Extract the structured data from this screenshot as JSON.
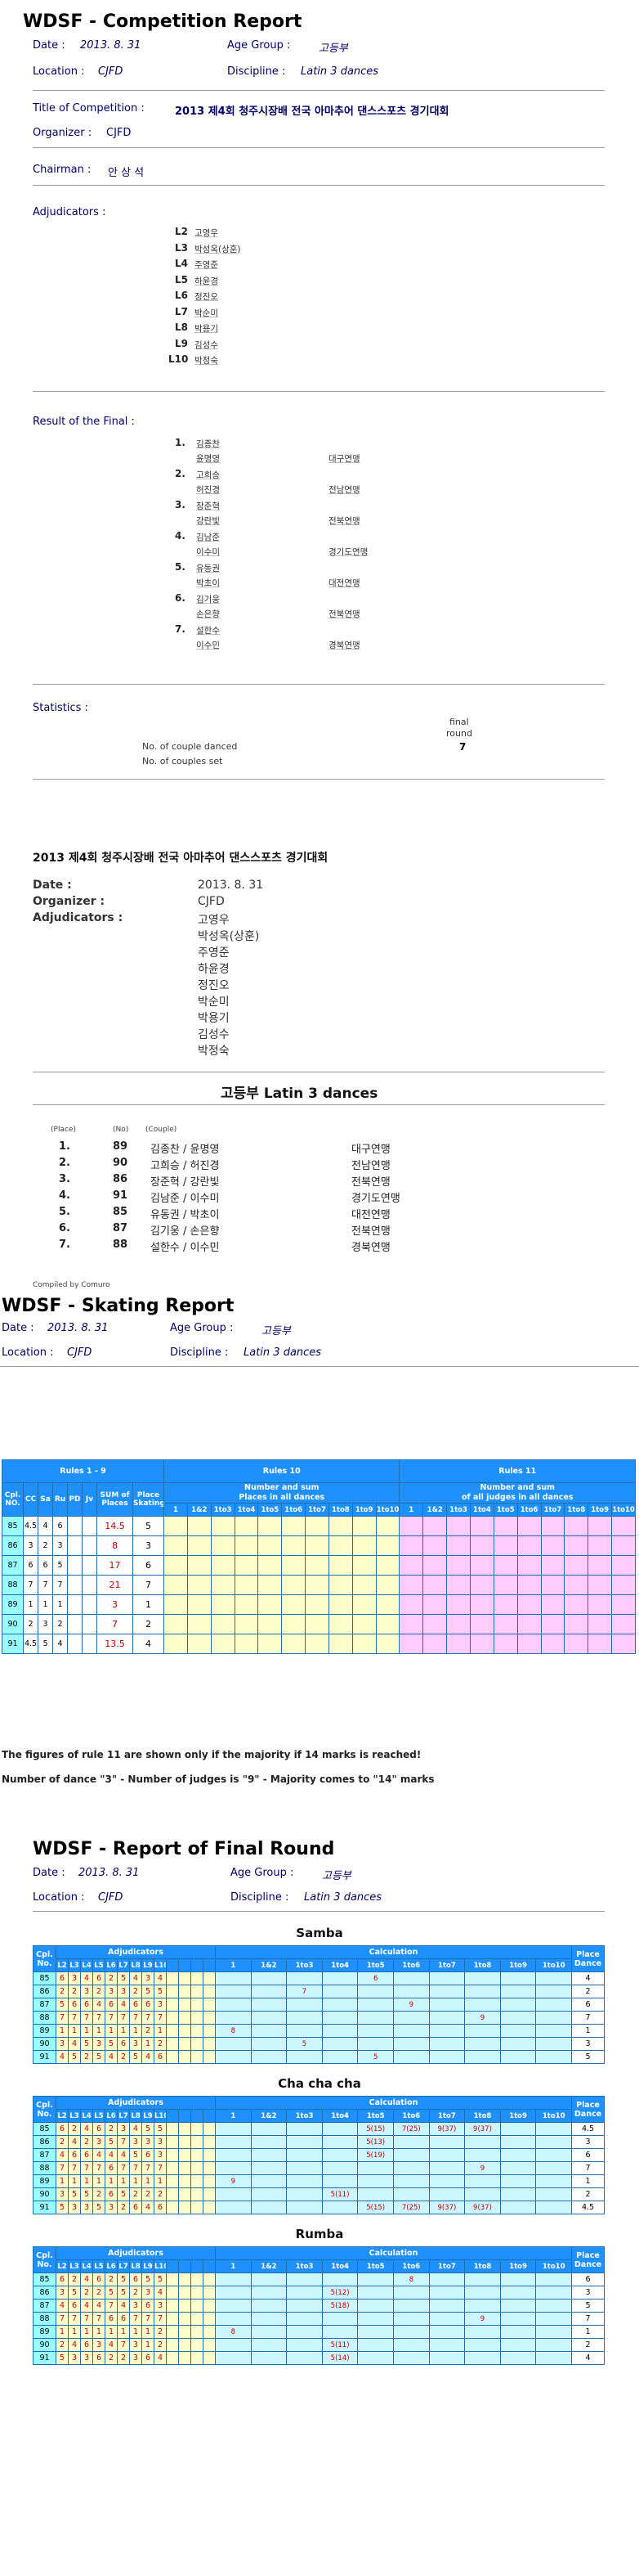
{
  "title": "WDSF - Competition Report",
  "meta": {
    "date_label": "Date :",
    "date": "2013. 8. 31",
    "age_label": "Age Group :",
    "age": "고등부",
    "loc_label": "Location :",
    "loc": "CJFD",
    "disc_label": "Discipline :",
    "disc": "Latin 3 dances"
  },
  "comp_label": "Title of Competition :",
  "comp": "2013 제4회 청주시장배 전국 아마추어 댄스스포츠 경기대회",
  "org_label": "Organizer :",
  "org": "CJFD",
  "chair_label": "Chairman :",
  "chair": "안 상 석",
  "adj_label": "Adjudicators :",
  "adjudicators": [
    {
      "code": "L2",
      "name": "고영우"
    },
    {
      "code": "L3",
      "name": "박성옥(상훈)"
    },
    {
      "code": "L4",
      "name": "주영준"
    },
    {
      "code": "L5",
      "name": "하윤경"
    },
    {
      "code": "L6",
      "name": "정진오"
    },
    {
      "code": "L7",
      "name": "박순미"
    },
    {
      "code": "L8",
      "name": "박용기"
    },
    {
      "code": "L9",
      "name": "김성수"
    },
    {
      "code": "L10",
      "name": "박정숙"
    }
  ],
  "final_label": "Result of the Final :",
  "finals": [
    {
      "place": "1.",
      "m": "김종찬",
      "f": "윤명영",
      "club": "대구연맹"
    },
    {
      "place": "2.",
      "m": "고희승",
      "f": "허진경",
      "club": "전남연맹"
    },
    {
      "place": "3.",
      "m": "장준혁",
      "f": "강란빛",
      "club": "전북연맹"
    },
    {
      "place": "4.",
      "m": "김남준",
      "f": "이수미",
      "club": "경기도연맹"
    },
    {
      "place": "5.",
      "m": "유동권",
      "f": "박초이",
      "club": "대전연맹"
    },
    {
      "place": "6.",
      "m": "김기웅",
      "f": "손은향",
      "club": "전북연맹"
    },
    {
      "place": "7.",
      "m": "설한수",
      "f": "이수민",
      "club": "경북연맹"
    }
  ],
  "stats": {
    "label": "Statistics :",
    "col1": "final",
    "col2": "round",
    "row1": "No. of couple danced",
    "row2": "No. of couples set",
    "value": "7"
  },
  "kr": {
    "title": "2013 제4회 청주시장배 전국 아마추어 댄스스포츠 경기대회",
    "date_label": "Date :",
    "date": "2013. 8. 31",
    "org_label": "Organizer :",
    "org": "CJFD",
    "adj_label": "Adjudicators :",
    "heading": "고등부 Latin 3 dances",
    "h_place": "(Place)",
    "h_no": "(No)",
    "h_couple": "(Couple)",
    "compiled": "Compiled by Comuro",
    "rows": [
      {
        "place": "1.",
        "no": "89",
        "couple": "김종찬 /  윤명영",
        "club": "대구연맹"
      },
      {
        "place": "2.",
        "no": "90",
        "couple": "고희승 /  허진경",
        "club": "전남연맹"
      },
      {
        "place": "3.",
        "no": "86",
        "couple": "장준혁 /  강란빛",
        "club": "전북연맹"
      },
      {
        "place": "4.",
        "no": "91",
        "couple": "김남준 /  이수미",
        "club": "경기도연맹"
      },
      {
        "place": "5.",
        "no": "85",
        "couple": "유동권 /  박초이",
        "club": "대전연맹"
      },
      {
        "place": "6.",
        "no": "87",
        "couple": "김기웅 /  손은향",
        "club": "전북연맹"
      },
      {
        "place": "7.",
        "no": "88",
        "couple": "설한수 /  이수민",
        "club": "경북연맹"
      }
    ]
  },
  "skating": {
    "title": "WDSF - Skating Report",
    "hdr_r19": "Rules 1 - 9",
    "hdr_r10": "Rules 10",
    "hdr_r11": "Rules 11",
    "r10_sub": "Number and sum",
    "r10_sub2": "Places in all dances",
    "r11_sub": "Number and sum",
    "r11_sub2": "of all judges in all dances",
    "cols": [
      "Cpl. NO.",
      "CC",
      "Sa",
      "Ru",
      "PD",
      "Jv",
      "SUM of Places",
      "Place Skating"
    ],
    "rank_cols": [
      "1",
      "1&2",
      "1to3",
      "1to4",
      "1to5",
      "1to6",
      "1to7",
      "1to8",
      "1to9",
      "1to10"
    ],
    "rows": [
      {
        "no": "85",
        "cc": "4.5",
        "sa": "4",
        "ru": "6",
        "sum": "14.5",
        "place": "5"
      },
      {
        "no": "86",
        "cc": "3",
        "sa": "2",
        "ru": "3",
        "sum": "8",
        "place": "3"
      },
      {
        "no": "87",
        "cc": "6",
        "sa": "6",
        "ru": "5",
        "sum": "17",
        "place": "6"
      },
      {
        "no": "88",
        "cc": "7",
        "sa": "7",
        "ru": "7",
        "sum": "21",
        "place": "7"
      },
      {
        "no": "89",
        "cc": "1",
        "sa": "1",
        "ru": "1",
        "sum": "3",
        "place": "1"
      },
      {
        "no": "90",
        "cc": "2",
        "sa": "3",
        "ru": "2",
        "sum": "7",
        "place": "2"
      },
      {
        "no": "91",
        "cc": "4.5",
        "sa": "5",
        "ru": "4",
        "sum": "13.5",
        "place": "4"
      }
    ],
    "note1": "The figures of rule 11 are shown only if the majority if 14 marks is reached!",
    "note2": "Number of dance \"3\" - Number of judges is \"9\" - Majority comes to \"14\" marks"
  },
  "final_round": {
    "title": "WDSF - Report of Final Round",
    "hdr_adj": "Adjudicators",
    "hdr_calc": "Calculation",
    "hdr_cpl": "Cpl. No.",
    "hdr_place": "Place Dance",
    "judges": [
      "L2",
      "L3",
      "L4",
      "L5",
      "L6",
      "L7",
      "L8",
      "L9",
      "L10"
    ],
    "calc_cols": [
      "1",
      "1&2",
      "1to3",
      "1to4",
      "1to5",
      "1to6",
      "1to7",
      "1to8",
      "1to9",
      "1to10"
    ],
    "dances": [
      {
        "name": "Samba",
        "rows": [
          {
            "no": "85",
            "marks": [
              "6",
              "3",
              "4",
              "6",
              "2",
              "5",
              "4",
              "3",
              "4"
            ],
            "calc": [
              "",
              "",
              "",
              "",
              "6",
              "",
              "",
              "",
              "",
              ""
            ],
            "place": "4"
          },
          {
            "no": "86",
            "marks": [
              "2",
              "2",
              "3",
              "2",
              "3",
              "3",
              "2",
              "5",
              "5"
            ],
            "calc": [
              "",
              "",
              "7",
              "",
              "",
              "",
              "",
              "",
              "",
              ""
            ],
            "place": "2"
          },
          {
            "no": "87",
            "marks": [
              "5",
              "6",
              "6",
              "4",
              "6",
              "4",
              "6",
              "6",
              "3"
            ],
            "calc": [
              "",
              "",
              "",
              "",
              "",
              "9",
              "",
              "",
              "",
              ""
            ],
            "place": "6"
          },
          {
            "no": "88",
            "marks": [
              "7",
              "7",
              "7",
              "7",
              "7",
              "7",
              "7",
              "7",
              "7"
            ],
            "calc": [
              "",
              "",
              "",
              "",
              "",
              "",
              "",
              "9",
              "",
              ""
            ],
            "place": "7"
          },
          {
            "no": "89",
            "marks": [
              "1",
              "1",
              "1",
              "1",
              "1",
              "1",
              "1",
              "2",
              "1"
            ],
            "calc": [
              "8",
              "",
              "",
              "",
              "",
              "",
              "",
              "",
              "",
              ""
            ],
            "place": "1"
          },
          {
            "no": "90",
            "marks": [
              "3",
              "4",
              "5",
              "3",
              "5",
              "6",
              "3",
              "1",
              "2"
            ],
            "calc": [
              "",
              "",
              "5",
              "",
              "",
              "",
              "",
              "",
              "",
              ""
            ],
            "place": "3"
          },
          {
            "no": "91",
            "marks": [
              "4",
              "5",
              "2",
              "5",
              "4",
              "2",
              "5",
              "4",
              "6"
            ],
            "calc": [
              "",
              "",
              "",
              "",
              "5",
              "",
              "",
              "",
              "",
              ""
            ],
            "place": "5"
          }
        ]
      },
      {
        "name": "Cha cha cha",
        "rows": [
          {
            "no": "85",
            "marks": [
              "6",
              "2",
              "4",
              "6",
              "2",
              "3",
              "4",
              "5",
              "5"
            ],
            "calc": [
              "",
              "",
              "",
              "",
              "5(15)",
              "7(25)",
              "9(37)",
              "9(37)",
              "",
              ""
            ],
            "place": "4.5"
          },
          {
            "no": "86",
            "marks": [
              "2",
              "4",
              "2",
              "3",
              "5",
              "7",
              "3",
              "3",
              "3"
            ],
            "calc": [
              "",
              "",
              "",
              "",
              "5(13)",
              "",
              "",
              "",
              "",
              ""
            ],
            "place": "3"
          },
          {
            "no": "87",
            "marks": [
              "4",
              "6",
              "6",
              "4",
              "4",
              "4",
              "5",
              "6",
              "3"
            ],
            "calc": [
              "",
              "",
              "",
              "",
              "5(19)",
              "",
              "",
              "",
              "",
              ""
            ],
            "place": "6"
          },
          {
            "no": "88",
            "marks": [
              "7",
              "7",
              "7",
              "7",
              "6",
              "7",
              "7",
              "7",
              "7"
            ],
            "calc": [
              "",
              "",
              "",
              "",
              "",
              "",
              "",
              "9",
              "",
              ""
            ],
            "place": "7"
          },
          {
            "no": "89",
            "marks": [
              "1",
              "1",
              "1",
              "1",
              "1",
              "1",
              "1",
              "1",
              "1"
            ],
            "calc": [
              "9",
              "",
              "",
              "",
              "",
              "",
              "",
              "",
              "",
              ""
            ],
            "place": "1"
          },
          {
            "no": "90",
            "marks": [
              "3",
              "5",
              "5",
              "2",
              "6",
              "5",
              "2",
              "2",
              "2"
            ],
            "calc": [
              "",
              "",
              "",
              "5(11)",
              "",
              "",
              "",
              "",
              "",
              ""
            ],
            "place": "2"
          },
          {
            "no": "91",
            "marks": [
              "5",
              "3",
              "3",
              "5",
              "3",
              "2",
              "6",
              "4",
              "6"
            ],
            "calc": [
              "",
              "",
              "",
              "",
              "5(15)",
              "7(25)",
              "9(37)",
              "9(37)",
              "",
              ""
            ],
            "place": "4.5"
          }
        ]
      },
      {
        "name": "Rumba",
        "rows": [
          {
            "no": "85",
            "marks": [
              "6",
              "2",
              "4",
              "6",
              "2",
              "5",
              "6",
              "5",
              "5"
            ],
            "calc": [
              "",
              "",
              "",
              "",
              "",
              "8",
              "",
              "",
              "",
              ""
            ],
            "place": "6"
          },
          {
            "no": "86",
            "marks": [
              "3",
              "5",
              "2",
              "2",
              "5",
              "5",
              "2",
              "3",
              "4"
            ],
            "calc": [
              "",
              "",
              "",
              "5(12)",
              "",
              "",
              "",
              "",
              "",
              ""
            ],
            "place": "3"
          },
          {
            "no": "87",
            "marks": [
              "4",
              "6",
              "4",
              "4",
              "7",
              "4",
              "3",
              "6",
              "3"
            ],
            "calc": [
              "",
              "",
              "",
              "5(18)",
              "",
              "",
              "",
              "",
              "",
              ""
            ],
            "place": "5"
          },
          {
            "no": "88",
            "marks": [
              "7",
              "7",
              "7",
              "7",
              "6",
              "6",
              "7",
              "7",
              "7"
            ],
            "calc": [
              "",
              "",
              "",
              "",
              "",
              "",
              "",
              "9",
              "",
              ""
            ],
            "place": "7"
          },
          {
            "no": "89",
            "marks": [
              "1",
              "1",
              "1",
              "1",
              "1",
              "1",
              "1",
              "1",
              "2"
            ],
            "calc": [
              "8",
              "",
              "",
              "",
              "",
              "",
              "",
              "",
              "",
              ""
            ],
            "place": "1"
          },
          {
            "no": "90",
            "marks": [
              "2",
              "4",
              "6",
              "3",
              "4",
              "7",
              "3",
              "1",
              "2"
            ],
            "calc": [
              "",
              "",
              "",
              "5(11)",
              "",
              "",
              "",
              "",
              "",
              ""
            ],
            "place": "2"
          },
          {
            "no": "91",
            "marks": [
              "5",
              "3",
              "3",
              "6",
              "2",
              "2",
              "3",
              "6",
              "4"
            ],
            "calc": [
              "",
              "",
              "",
              "5(14)",
              "",
              "",
              "",
              "",
              "",
              ""
            ],
            "place": "4"
          }
        ]
      }
    ]
  }
}
